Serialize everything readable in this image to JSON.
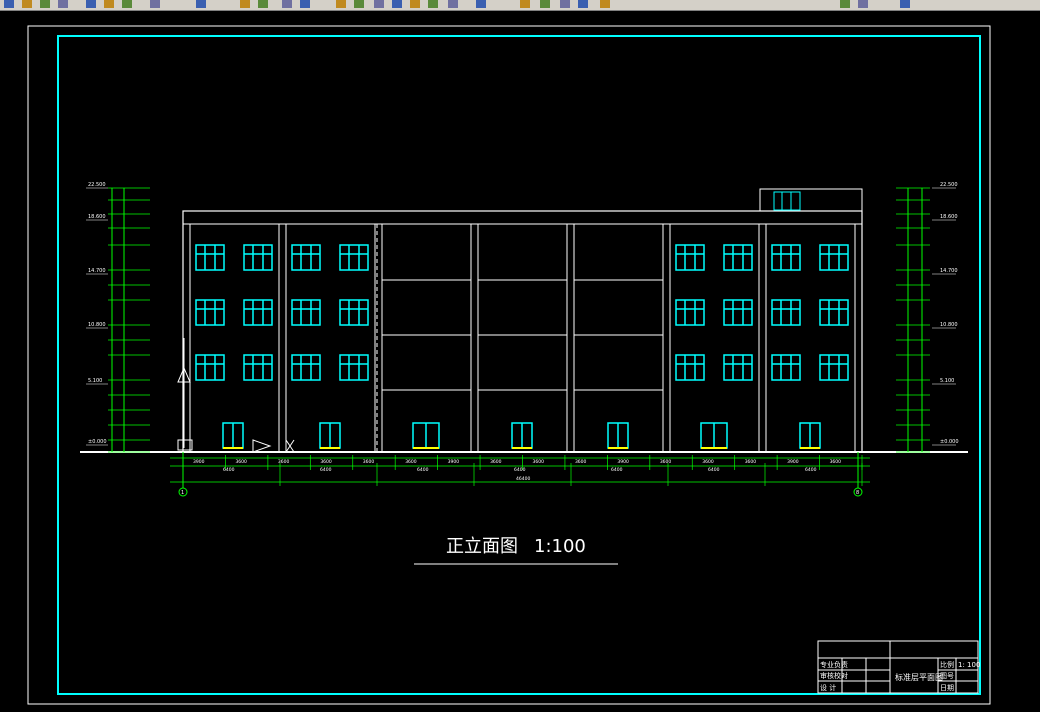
{
  "toolbar": {
    "icons": [
      "undo-icon",
      "open-icon",
      "save-icon",
      "print-icon",
      "cut-icon",
      "copy-icon",
      "paste-icon",
      "match-icon",
      "layer-icon",
      "zoom-icon",
      "pan-icon",
      "properties-icon",
      "design-center-icon",
      "block-icon",
      "tool-palette-icon",
      "help-icon"
    ]
  },
  "drawing": {
    "title": "正立面图",
    "scale": "1:100",
    "axis_left": "1",
    "axis_right": "8",
    "elevations_left": [
      "22.500",
      "18.600",
      "14.700",
      "10.800",
      "5.100",
      "±0.000"
    ],
    "elevations_right": [
      "22.500",
      "18.600",
      "14.700",
      "10.800",
      "5.100",
      "±0.000"
    ],
    "dims_top": [
      "3900",
      "3600",
      "3600",
      "3600",
      "3600",
      "3600",
      "3900",
      "3600",
      "3600",
      "3600",
      "3900",
      "3600",
      "3600",
      "3600",
      "3900",
      "3600"
    ],
    "dims_mid": [
      "6400",
      "6400",
      "6400",
      "6400",
      "6400",
      "6400",
      "6400"
    ],
    "dims_total": "46400"
  },
  "title_block": {
    "rows_left": [
      "专业负责",
      "审核校对",
      "设 计"
    ],
    "sheet_name": "标准层平面图",
    "scale_label": "比例",
    "scale_value": "1: 100",
    "drawing_no_label": "图号",
    "date_label": "日期"
  },
  "colors": {
    "frame": "#00ffff",
    "lines": "#ffffff",
    "windows": "#00ffff",
    "dimensions": "#00ff00",
    "ground": "#ffffff"
  }
}
